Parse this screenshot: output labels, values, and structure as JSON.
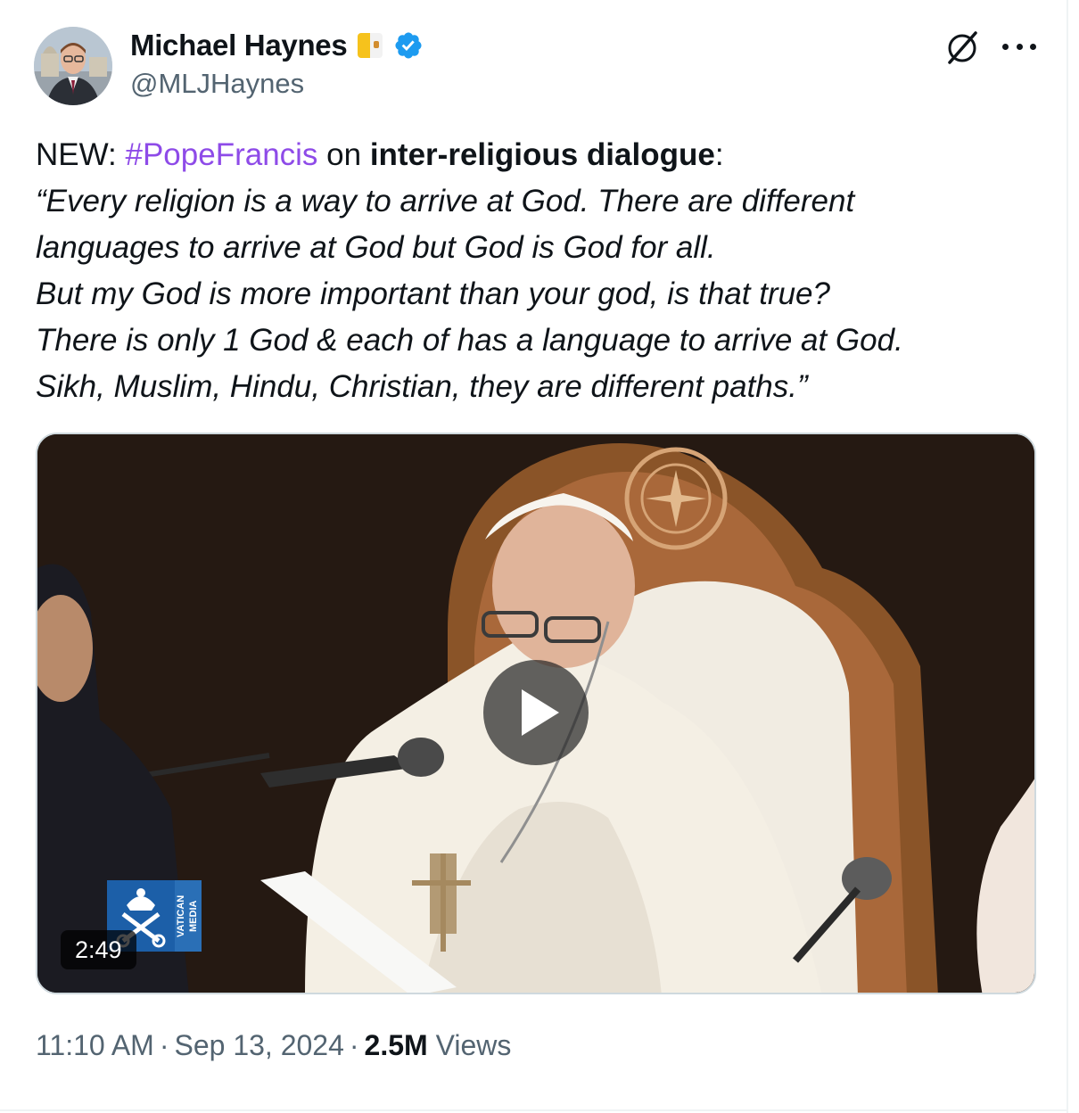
{
  "author": {
    "display_name": "Michael Haynes",
    "handle": "@MLJHaynes",
    "flag_icon": "vatican-flag-icon",
    "verified_icon": "verified-badge-icon",
    "verified_color": "#1d9bf0"
  },
  "actions": {
    "grok_icon": "grok-icon",
    "more_icon": "more-options-icon"
  },
  "tweet": {
    "prefix": "NEW: ",
    "hashtag": "#PopeFrancis",
    "on_word": " on ",
    "topic": "inter-religious dialogue",
    "colon": ":",
    "quote_lines": [
      "“Every religion is a way to arrive at God. There are different",
      "languages to arrive at God but God is God for all.",
      "But my God is more important than your god, is that true?",
      "There is only 1 God & each of has a language to arrive at God.",
      "Sikh, Muslim, Hindu, Christian, they are different paths.”"
    ],
    "hashtag_color": "#8e4be8"
  },
  "media": {
    "duration": "2:49",
    "play_icon": "play-icon",
    "watermark_text": "VATICAN MEDIA"
  },
  "meta": {
    "time": "11:10 AM",
    "dot": "·",
    "date": "Sep 13, 2024",
    "views_count": "2.5M",
    "views_label": "Views"
  }
}
